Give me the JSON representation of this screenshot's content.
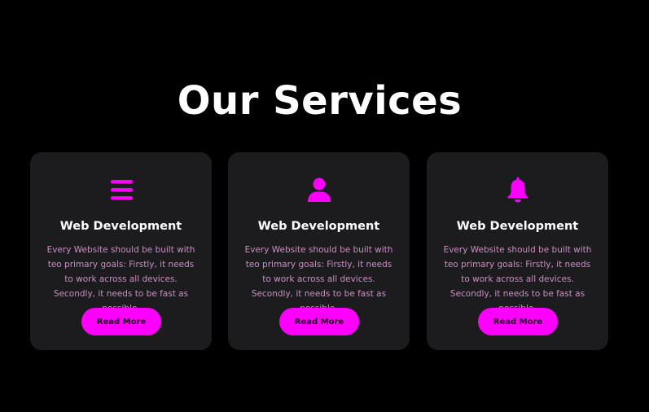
{
  "page": {
    "heading": "Our Services"
  },
  "colors": {
    "background": "#000000",
    "card_background": "#1c1c1e",
    "accent": "#ff00ff",
    "title": "#ffffff",
    "body_text": "#c78fc3"
  },
  "cards": [
    {
      "icon": "menu-bars-icon",
      "title": "Web Development",
      "text": "Every Website should be built with teo primary goals: Firstly, it needs to work across all devices. Secondly, it needs to be fast as possible.",
      "button_label": "Read More"
    },
    {
      "icon": "user-icon",
      "title": "Web Development",
      "text": "Every Website should be built with teo primary goals: Firstly, it needs to work across all devices. Secondly, it needs to be fast as possible.",
      "button_label": "Read More"
    },
    {
      "icon": "bell-icon",
      "title": "Web Development",
      "text": "Every Website should be built with teo primary goals: Firstly, it needs to work across all devices. Secondly, it needs to be fast as possible.",
      "button_label": "Read More"
    }
  ]
}
